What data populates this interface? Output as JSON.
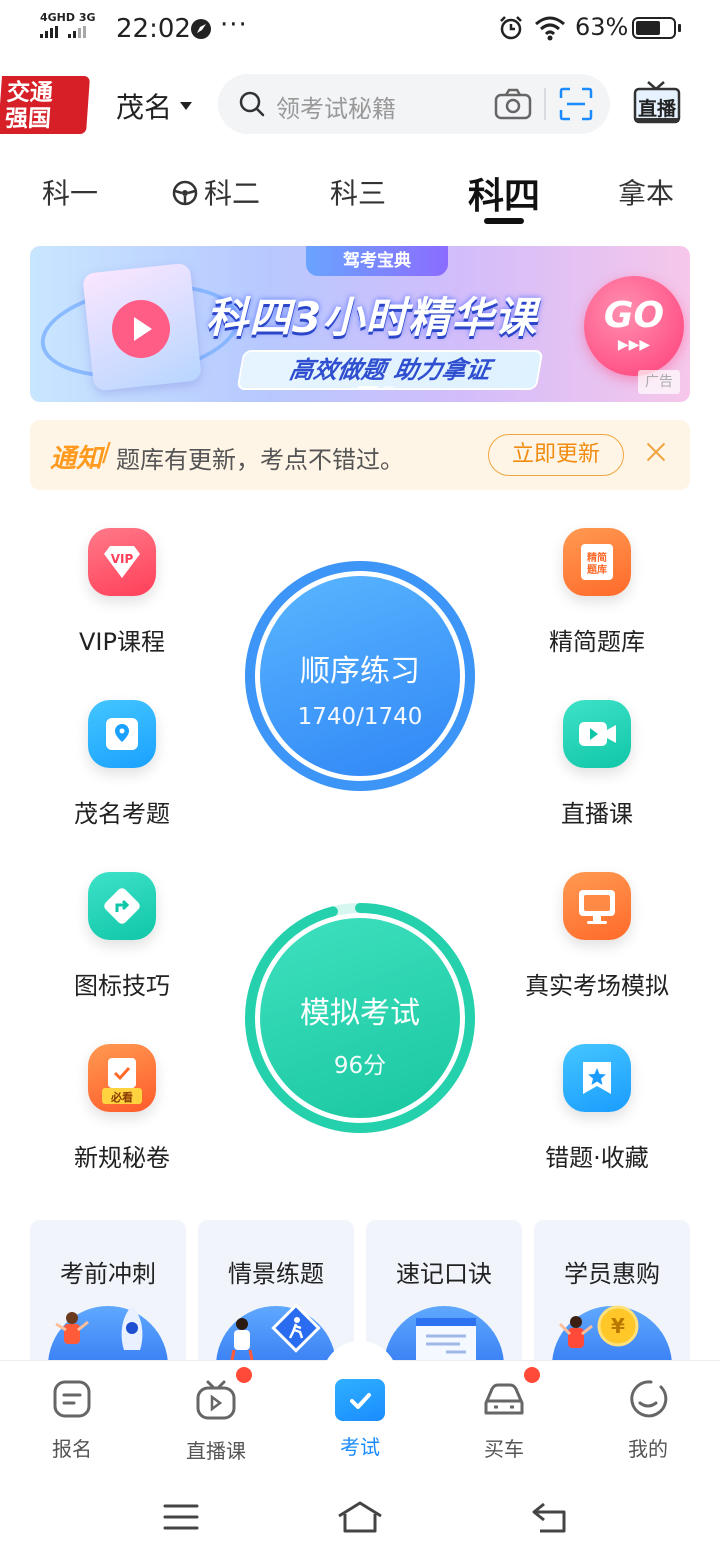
{
  "status_bar": {
    "network": "4GHD 3G",
    "time": "22:02",
    "battery": "63%"
  },
  "header": {
    "logo_text": "交通强国",
    "city": "茂名",
    "search_placeholder": "领考试秘籍",
    "live_label": "直播"
  },
  "tabs": [
    "科一",
    "科二",
    "科三",
    "科四",
    "拿本"
  ],
  "active_tab": "科四",
  "banner": {
    "tag": "驾考宝典",
    "title": "科四3小时精华课",
    "subtitle": "高效做题  助力拿证",
    "go": "GO",
    "ad": "广告"
  },
  "notice": {
    "label": "通知",
    "text": "题库有更新，考点不错过。",
    "button": "立即更新"
  },
  "features_left": [
    {
      "label": "VIP课程",
      "icon": "vip-icon"
    },
    {
      "label": "茂名考题",
      "icon": "location-icon"
    },
    {
      "label": "图标技巧",
      "icon": "road-sign-icon"
    },
    {
      "label": "新规秘卷",
      "icon": "checklist-icon"
    }
  ],
  "features_right": [
    {
      "label": "精简题库",
      "icon": "book-icon"
    },
    {
      "label": "直播课",
      "icon": "video-icon"
    },
    {
      "label": "真实考场模拟",
      "icon": "monitor-icon"
    },
    {
      "label": "错题·收藏",
      "icon": "star-bookmark-icon"
    }
  ],
  "practice": {
    "title": "顺序练习",
    "progress": "1740/1740",
    "progress_fraction": 1.0
  },
  "mock_exam": {
    "title": "模拟考试",
    "score": "96分",
    "score_fraction": 0.96
  },
  "quick_cards": [
    "考前冲刺",
    "情景练题",
    "速记口诀",
    "学员惠购"
  ],
  "bottom_nav": [
    {
      "label": "报名",
      "active": false,
      "badge": false
    },
    {
      "label": "直播课",
      "active": false,
      "badge": true
    },
    {
      "label": "考试",
      "active": true,
      "badge": false
    },
    {
      "label": "买车",
      "active": false,
      "badge": true
    },
    {
      "label": "我的",
      "active": false,
      "badge": false
    }
  ],
  "colors": {
    "accent": "#1a8cff",
    "notice_orange": "#ff9a1f",
    "brand_red": "#d61f26",
    "practice_blue": "#2f86f6",
    "exam_green": "#19c7a0"
  }
}
